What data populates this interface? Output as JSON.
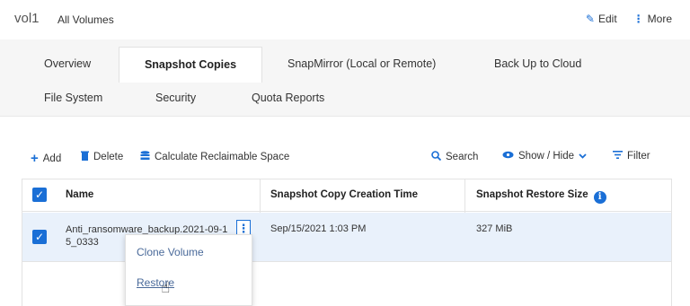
{
  "header": {
    "volume": "vol1",
    "breadcrumb": "All Volumes",
    "edit_label": "Edit",
    "more_label": "More"
  },
  "tabs": [
    {
      "label": "Overview",
      "active": false
    },
    {
      "label": "Snapshot Copies",
      "active": true
    },
    {
      "label": "SnapMirror (Local or Remote)",
      "active": false
    },
    {
      "label": "Back Up to Cloud",
      "active": false
    },
    {
      "label": "File System",
      "active": false
    },
    {
      "label": "Security",
      "active": false
    },
    {
      "label": "Quota Reports",
      "active": false
    }
  ],
  "toolbar": {
    "add": "Add",
    "delete": "Delete",
    "calc": "Calculate Reclaimable Space",
    "search": "Search",
    "showhide": "Show / Hide",
    "filter": "Filter"
  },
  "table": {
    "columns": [
      "Name",
      "Snapshot Copy Creation Time",
      "Snapshot Restore Size"
    ],
    "rows": [
      {
        "name_line1": "Anti_ransomware_backup.2021-09-1",
        "name_line2": "5_0333",
        "time": "Sep/15/2021 1:03 PM",
        "size": "327 MiB",
        "selected": true
      }
    ]
  },
  "row_menu": {
    "items": [
      "Clone Volume",
      "Restore"
    ]
  },
  "colors": {
    "accent": "#1a6fd6",
    "row_selected": "#e9f1fb",
    "tab_bar": "#f6f6f6"
  }
}
